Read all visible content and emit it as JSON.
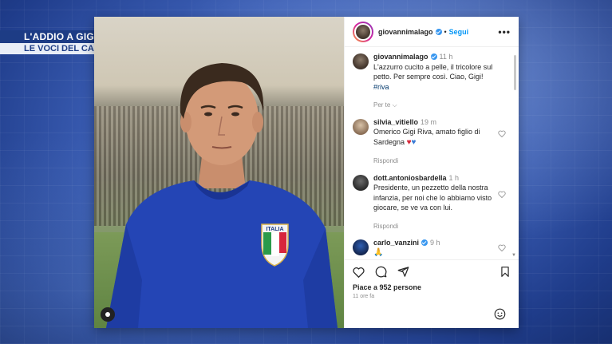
{
  "caption": {
    "line1": "L'ADDIO A GIGI RIVA",
    "line2": "LE VOCI DEL CALCIO"
  },
  "post": {
    "author": "giovannimalago",
    "follow_label": "Segui",
    "dot": "•",
    "more_label": "•••",
    "jersey_text": "ITALIA"
  },
  "comments": [
    {
      "user": "giovannimalago",
      "time": "11 h",
      "text": "L'azzurro cucito a pelle, il tricolore sul petto. Per sempre così. Ciao, Gigi!",
      "hashtag": "#riva",
      "meta": "Per te ⌵"
    },
    {
      "user": "silvia_vitiello",
      "time": "19 m",
      "text": "Omerico Gigi Riva, amato figlio di Sardegna",
      "emoji_red": "♥",
      "emoji_blue": "♥",
      "meta": "Rispondi"
    },
    {
      "user": "dott.antoniosbardella",
      "time": "1 h",
      "text": "Presidente, un pezzetto della nostra infanzia, per noi che lo abbiamo visto giocare, se ve va con lui.",
      "meta": "Rispondi"
    },
    {
      "user": "carlo_vanzini",
      "time": "9 h",
      "emoji": "🙏"
    }
  ],
  "likes": "Piace a 952 persone",
  "time_ago": "11 ore fa",
  "icons": {
    "heart": "heart-icon",
    "comment": "comment-icon",
    "share": "share-icon",
    "bookmark": "bookmark-icon",
    "emoji": "emoji-icon",
    "verified": "verified-badge-icon"
  },
  "colors": {
    "accent": "#0095f6",
    "caption_bg": "#1d3c85",
    "jersey": "#2445b5"
  }
}
